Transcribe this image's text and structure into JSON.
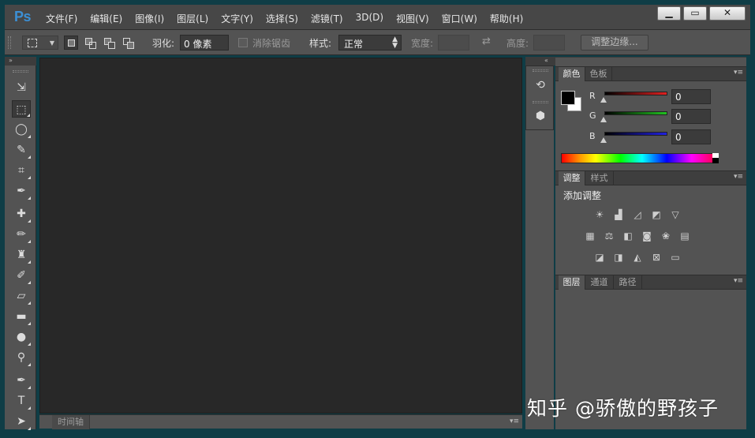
{
  "app": {
    "logo": "Ps",
    "menu": [
      "文件(F)",
      "编辑(E)",
      "图像(I)",
      "图层(L)",
      "文字(Y)",
      "选择(S)",
      "滤镜(T)",
      "3D(D)",
      "视图(V)",
      "窗口(W)",
      "帮助(H)"
    ],
    "window_controls": {
      "minimize": "▁",
      "maximize": "▭",
      "close": "✕"
    }
  },
  "options": {
    "feather_label": "羽化:",
    "feather_value": "0 像素",
    "antialias_label": "消除锯齿",
    "style_label": "样式:",
    "style_value": "正常",
    "width_label": "宽度:",
    "height_label": "高度:",
    "refine_edge": "调整边缘..."
  },
  "tools": [
    {
      "name": "move-tool",
      "glyph": "⇲"
    },
    {
      "name": "rect-marquee-tool",
      "glyph": "⬚"
    },
    {
      "name": "lasso-tool",
      "glyph": "◯"
    },
    {
      "name": "quick-select-tool",
      "glyph": "✎"
    },
    {
      "name": "crop-tool",
      "glyph": "⌗"
    },
    {
      "name": "eyedropper-tool",
      "glyph": "✒"
    },
    {
      "name": "healing-brush-tool",
      "glyph": "✚"
    },
    {
      "name": "brush-tool",
      "glyph": "✏"
    },
    {
      "name": "clone-stamp-tool",
      "glyph": "♜"
    },
    {
      "name": "history-brush-tool",
      "glyph": "✐"
    },
    {
      "name": "eraser-tool",
      "glyph": "▱"
    },
    {
      "name": "gradient-tool",
      "glyph": "▬"
    },
    {
      "name": "blur-tool",
      "glyph": "●"
    },
    {
      "name": "dodge-tool",
      "glyph": "⚲"
    },
    {
      "name": "pen-tool",
      "glyph": "✒"
    },
    {
      "name": "type-tool",
      "glyph": "T"
    },
    {
      "name": "path-select-tool",
      "glyph": "➤"
    }
  ],
  "timeline": {
    "tab": "时间轴"
  },
  "color_panel": {
    "tabs": [
      "颜色",
      "色板"
    ],
    "channels": [
      {
        "label": "R",
        "value": "0",
        "color": "#e02020"
      },
      {
        "label": "G",
        "value": "0",
        "color": "#20c020"
      },
      {
        "label": "B",
        "value": "0",
        "color": "#2020e0"
      }
    ],
    "foreground": "#000000",
    "background": "#ffffff"
  },
  "adjustments_panel": {
    "tabs": [
      "调整",
      "样式"
    ],
    "title": "添加调整",
    "icons": [
      [
        "brightness-icon",
        "levels-icon",
        "curves-icon",
        "exposure-icon",
        "vibrance-icon"
      ],
      [
        "hue-sat-icon",
        "color-balance-icon",
        "bw-icon",
        "photo-filter-icon",
        "channel-mixer-icon",
        "color-lookup-icon"
      ],
      [
        "invert-icon",
        "posterize-icon",
        "threshold-icon",
        "selective-color-icon",
        "gradient-map-icon"
      ]
    ]
  },
  "layers_panel": {
    "tabs": [
      "图层",
      "通道",
      "路径"
    ]
  },
  "watermark": "知乎 @骄傲的野孩子"
}
